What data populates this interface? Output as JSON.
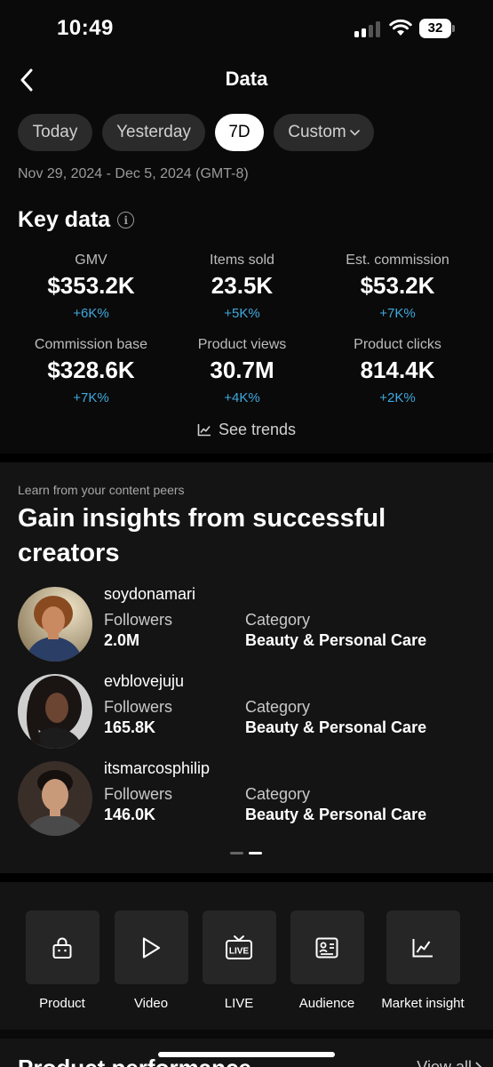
{
  "status_bar": {
    "time": "10:49",
    "battery": "32"
  },
  "nav": {
    "title": "Data"
  },
  "filters": [
    {
      "label": "Today",
      "active": false
    },
    {
      "label": "Yesterday",
      "active": false
    },
    {
      "label": "7D",
      "active": true
    },
    {
      "label": "Custom",
      "active": false
    }
  ],
  "date_range": "Nov 29, 2024 - Dec 5, 2024 (GMT-8)",
  "key_data": {
    "title": "Key data",
    "metrics": [
      {
        "label": "GMV",
        "value": "$353.2K",
        "change": "+6K%"
      },
      {
        "label": "Items sold",
        "value": "23.5K",
        "change": "+5K%"
      },
      {
        "label": "Est. commission",
        "value": "$53.2K",
        "change": "+7K%"
      },
      {
        "label": "Commission base",
        "value": "$328.6K",
        "change": "+7K%"
      },
      {
        "label": "Product views",
        "value": "30.7M",
        "change": "+4K%"
      },
      {
        "label": "Product clicks",
        "value": "814.4K",
        "change": "+2K%"
      }
    ],
    "see_trends": "See trends"
  },
  "peers": {
    "subtitle": "Learn from your content peers",
    "title": "Gain insights from successful creators",
    "creators": [
      {
        "name": "soydonamari",
        "followers_label": "Followers",
        "followers": "2.0M",
        "category_label": "Category",
        "category": "Beauty & Personal Care"
      },
      {
        "name": "evblovejuju",
        "followers_label": "Followers",
        "followers": "165.8K",
        "category_label": "Category",
        "category": "Beauty & Personal Care"
      },
      {
        "name": "itsmarcosphilip",
        "followers_label": "Followers",
        "followers": "146.0K",
        "category_label": "Category",
        "category": "Beauty & Personal Care"
      }
    ]
  },
  "tools": [
    {
      "label": "Product",
      "icon": "shopping-bag-icon"
    },
    {
      "label": "Video",
      "icon": "play-icon"
    },
    {
      "label": "LIVE",
      "icon": "live-tv-icon"
    },
    {
      "label": "Audience",
      "icon": "id-card-icon"
    },
    {
      "label": "Market insight",
      "icon": "line-chart-icon"
    }
  ],
  "performance": {
    "title": "Product performance",
    "view_all": "View all"
  },
  "colors": {
    "background": "#0a0a0a",
    "section": "#141414",
    "accent_change": "#3fa9df",
    "pill": "#2b2b2b",
    "pill_active": "#ffffff"
  }
}
